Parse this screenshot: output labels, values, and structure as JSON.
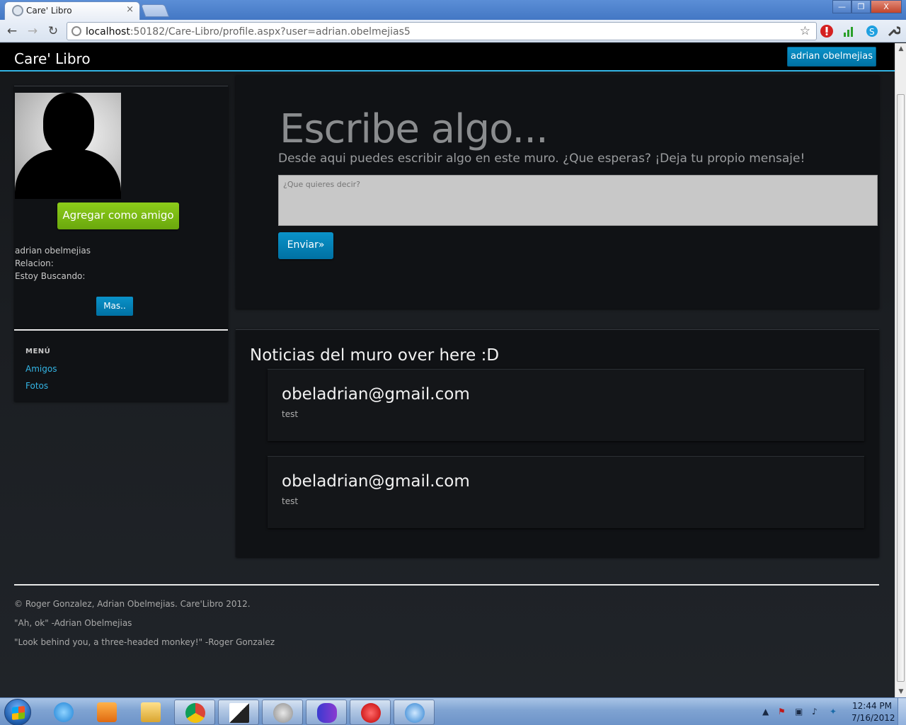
{
  "browser": {
    "tab_title": "Care' Libro",
    "tab_close": "×",
    "url_host": "localhost",
    "url_rest": ":50182/Care-Libro/profile.aspx?user=adrian.obelmejias5",
    "window_buttons": {
      "minimize": "—",
      "maximize": "❐",
      "close": "X"
    },
    "nav": {
      "back": "←",
      "forward": "→",
      "reload": "↻"
    },
    "star": "☆",
    "extensions": [
      "stop-extension-icon",
      "signal-extension-icon",
      "skype-extension-icon",
      "wrench-icon"
    ]
  },
  "navbar": {
    "brand": "Care' Libro",
    "user_button": "adrian obelmejias"
  },
  "profile": {
    "add_friend_label": "Agregar como amigo",
    "name": "adrian obelmejias",
    "relation_label": "Relacion:",
    "looking_label": "Estoy Buscando:",
    "more_label": "Mas.."
  },
  "menu": {
    "header": "MENÚ",
    "items": [
      "Amigos",
      "Fotos"
    ]
  },
  "post": {
    "title": "Escribe algo...",
    "subtitle": "Desde aqui puedes escribir algo en este muro. ¿Que esperas? ¡Deja tu propio mensaje!",
    "placeholder": "¿Que quieres decir?",
    "send_label": "Enviar»"
  },
  "wall": {
    "title": "Noticias del muro over here :D",
    "items": [
      {
        "author": "obeladrian@gmail.com",
        "text": "test"
      },
      {
        "author": "obeladrian@gmail.com",
        "text": "test"
      }
    ]
  },
  "footer": {
    "copyright": "© Roger Gonzalez, Adrian Obelmejias. Care'Libro 2012.",
    "quote1": "\"Ah, ok\" -Adrian Obelmejias",
    "quote2": "\"Look behind you, a three-headed monkey!\" -Roger Gonzalez"
  },
  "taskbar": {
    "items": [
      "ie-icon",
      "media-player-icon",
      "explorer-icon",
      "chrome-icon",
      "unity-icon",
      "gplus-icon",
      "infinity-icon",
      "opera-mail-icon",
      "itunes-icon"
    ],
    "active_item": "chrome-icon",
    "time": "12:44 PM",
    "date": "7/16/2012"
  },
  "colors": {
    "accent": "#33b5e5",
    "button_blue": "#0a92c9",
    "button_green": "#8ccc1a",
    "page_bg": "#1b1e22"
  }
}
